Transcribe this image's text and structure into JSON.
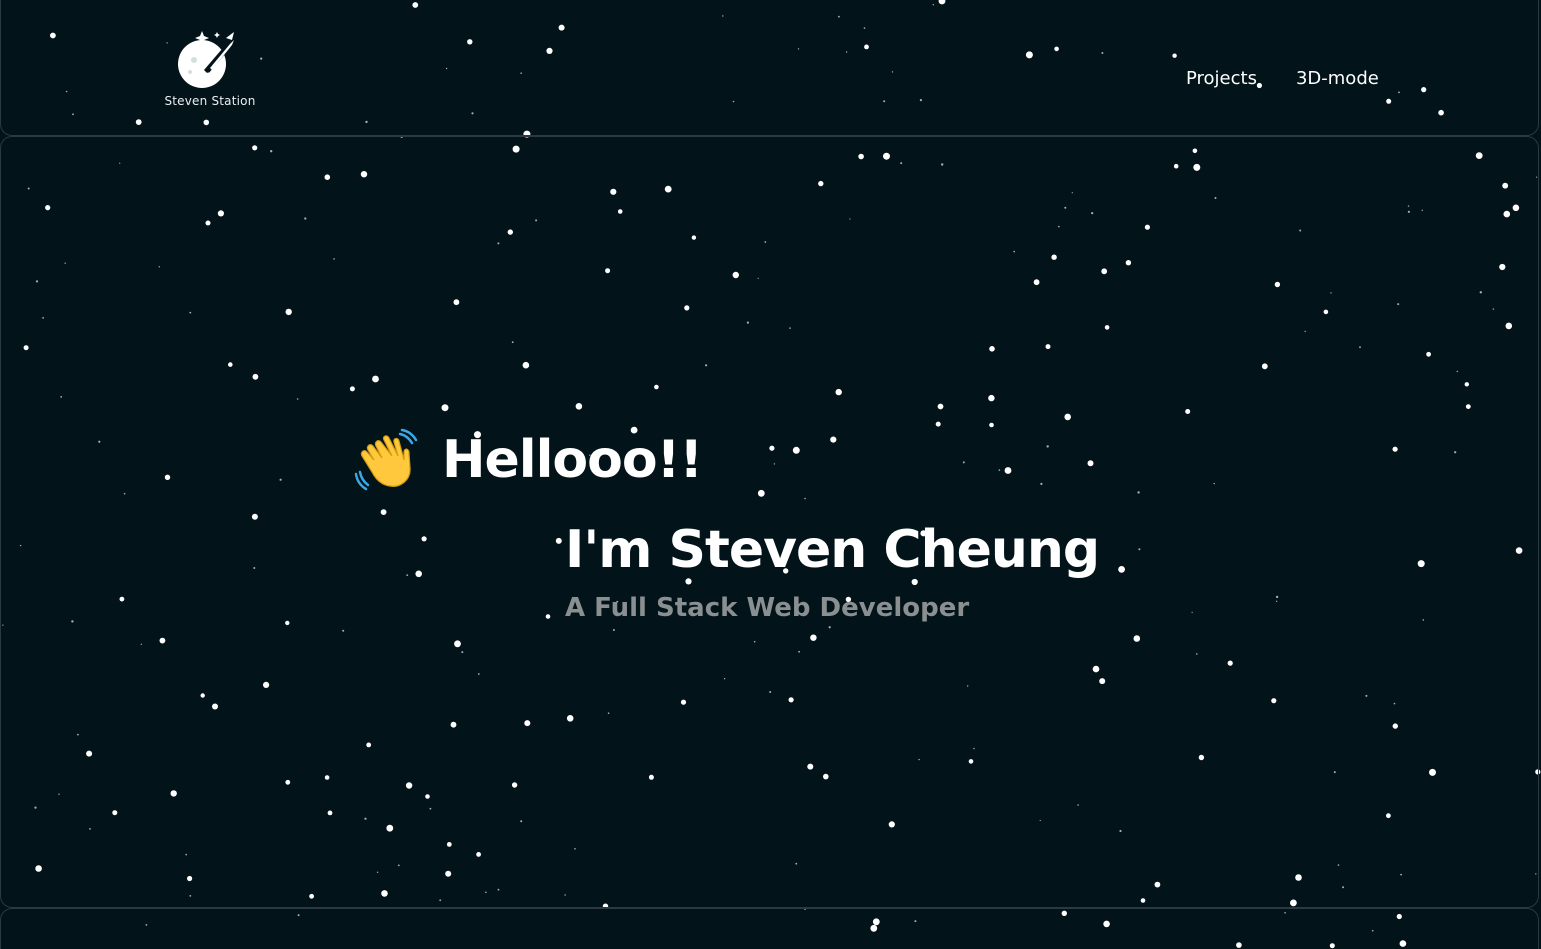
{
  "header": {
    "logo_text": "Steven Station",
    "nav": [
      {
        "label": "Projects"
      },
      {
        "label": "3D-mode"
      }
    ]
  },
  "hero": {
    "greeting_icon": "waving-hand-icon",
    "greeting": "Hellooo!!",
    "name": "I'm Steven Cheung",
    "role": "A Full Stack Web Developer"
  },
  "colors": {
    "background": "#03131a",
    "panel_border": "#2b3a42",
    "text": "#ffffff",
    "subtitle": "#8a8f91",
    "wave_hand": "#ffc83d"
  }
}
